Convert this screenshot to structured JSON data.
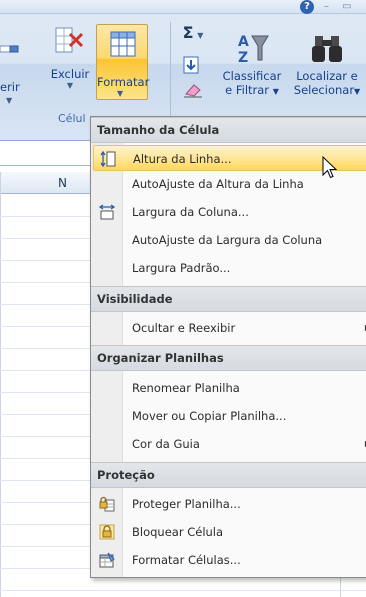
{
  "ribbon": {
    "partial_label": "erir",
    "excluir": {
      "label": "Excluir"
    },
    "formatar": {
      "label": "Formatar"
    },
    "autosum": {
      "symbol": "Σ"
    },
    "classificar": {
      "line1": "Classificar",
      "line2": "e Filtrar"
    },
    "localizar": {
      "line1": "Localizar e",
      "line2": "Selecionar"
    },
    "group_label": "Célul",
    "help": "?"
  },
  "sheet": {
    "column_n": "N"
  },
  "menu": {
    "sections": [
      {
        "header": "Tamanho da Célula",
        "items": [
          {
            "label": "Altura da Linha...",
            "icon": "row-height-icon",
            "highlighted": true
          },
          {
            "label": "AutoAjuste da Altura da Linha"
          },
          {
            "label": "Largura da Coluna...",
            "icon": "column-width-icon"
          },
          {
            "label": "AutoAjuste da Largura da Coluna"
          },
          {
            "label": "Largura Padrão..."
          }
        ]
      },
      {
        "header": "Visibilidade",
        "items": [
          {
            "label": "Ocultar e Reexibir",
            "submenu": true
          }
        ]
      },
      {
        "header": "Organizar Planilhas",
        "items": [
          {
            "label": "Renomear Planilha"
          },
          {
            "label": "Mover ou Copiar Planilha..."
          },
          {
            "label": "Cor da Guia",
            "submenu": true
          }
        ]
      },
      {
        "header": "Proteção",
        "items": [
          {
            "label": "Proteger Planilha...",
            "icon": "protect-sheet-icon"
          },
          {
            "label": "Bloquear Célula",
            "icon": "lock-cell-icon"
          },
          {
            "label": "Formatar Células...",
            "icon": "format-cells-icon"
          }
        ]
      }
    ]
  },
  "colors": {
    "highlight": "#ffe79a",
    "ribbon_text": "#15428b",
    "header_bg": "#dde1e6"
  }
}
